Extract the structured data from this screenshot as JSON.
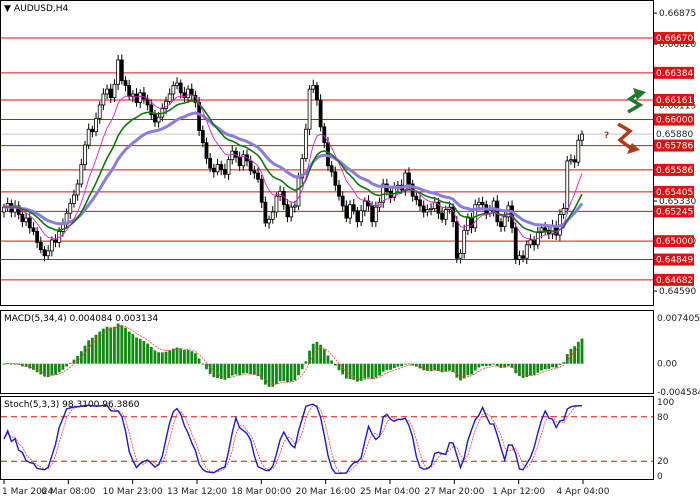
{
  "chart": {
    "symbol": "AUDUSD,H4"
  },
  "colors": {
    "candle": "#000000",
    "level": "#dd1111",
    "level_tag_bg": "#dd1111",
    "ma_green": "#0a7a0a",
    "ma_blue": "#8a7ce0",
    "ma_magenta": "#dd22cc",
    "macd_hist": "#118811",
    "macd_signal": "#ff3b3b",
    "stoch_main": "#1a1acc",
    "stoch_signal": "#ff3b3b",
    "stoch_level": "#dd1111",
    "up_arrow": "#1f7a30",
    "down_arrow": "#b33a1a",
    "grid": "#c8c8c8"
  },
  "arrows": {
    "up_icon": "up-zigzag-arrow-icon",
    "down_icon": "down-zigzag-arrow-icon",
    "question_mark": "?"
  },
  "macd": {
    "label": "MACD(5,34,4) 0.004084 0.003134"
  },
  "stoch": {
    "label": "Stoch(5,3,3) 98.3100 96.3860"
  },
  "chart_data": [
    {
      "type": "candlestick",
      "name": "price",
      "title": "AUDUSD,H4",
      "ylim": [
        0.645,
        0.6695
      ],
      "y_axis_labels": [
        "0.66875",
        "0.66620",
        "0.66115",
        "0.65330",
        "0.65000",
        "0.64590"
      ],
      "levels": [
        {
          "value": 0.6667,
          "label": "0.66670"
        },
        {
          "value": 0.66384,
          "label": "0.66384"
        },
        {
          "value": 0.66161,
          "label": "0.66161"
        },
        {
          "value": 0.66,
          "label": "0.66000"
        },
        {
          "value": 0.6588,
          "label": "0.65880",
          "current": true
        },
        {
          "value": 0.65786,
          "label": "0.65786"
        },
        {
          "value": 0.65586,
          "label": "0.65586"
        },
        {
          "value": 0.65405,
          "label": "0.65405"
        },
        {
          "value": 0.65245,
          "label": "0.65245"
        },
        {
          "value": 0.65,
          "label": "0.65000"
        },
        {
          "value": 0.64849,
          "label": "0.64849"
        },
        {
          "value": 0.64682,
          "label": "0.64682"
        }
      ],
      "x_labels": [
        "1 Mar 2024",
        "6 Mar 08:00",
        "10 Mar 23:00",
        "13 Mar 12:00",
        "18 Mar 00:00",
        "20 Mar 16:00",
        "25 Mar 04:00",
        "27 Mar 20:00",
        "1 Apr 12:00",
        "4 Apr 04:00"
      ],
      "close": [
        0.6528,
        0.6531,
        0.6524,
        0.6529,
        0.6522,
        0.6516,
        0.6519,
        0.6511,
        0.6508,
        0.6499,
        0.6493,
        0.6488,
        0.6492,
        0.6501,
        0.6499,
        0.6508,
        0.6514,
        0.6523,
        0.6531,
        0.6538,
        0.6547,
        0.6563,
        0.6579,
        0.6592,
        0.659,
        0.6601,
        0.6612,
        0.6621,
        0.6625,
        0.6618,
        0.6629,
        0.6649,
        0.6632,
        0.6628,
        0.6619,
        0.6621,
        0.6614,
        0.6622,
        0.6617,
        0.6612,
        0.6604,
        0.6598,
        0.6602,
        0.6609,
        0.6615,
        0.6621,
        0.6628,
        0.663,
        0.6622,
        0.6618,
        0.6625,
        0.662,
        0.6614,
        0.6591,
        0.6581,
        0.6568,
        0.656,
        0.6557,
        0.6563,
        0.6559,
        0.6555,
        0.6567,
        0.6574,
        0.6569,
        0.6562,
        0.6571,
        0.6566,
        0.6558,
        0.6556,
        0.6551,
        0.6532,
        0.6515,
        0.6518,
        0.6524,
        0.6537,
        0.6541,
        0.653,
        0.652,
        0.6528,
        0.6529,
        0.6552,
        0.6568,
        0.6592,
        0.6625,
        0.6628,
        0.6616,
        0.6594,
        0.6581,
        0.6562,
        0.6557,
        0.6546,
        0.6537,
        0.6529,
        0.6519,
        0.653,
        0.6525,
        0.6516,
        0.6525,
        0.6533,
        0.6529,
        0.6516,
        0.6528,
        0.6532,
        0.6547,
        0.6541,
        0.6536,
        0.6544,
        0.6546,
        0.6542,
        0.6556,
        0.6547,
        0.6537,
        0.6534,
        0.6529,
        0.6524,
        0.6526,
        0.6527,
        0.6532,
        0.6523,
        0.6518,
        0.6526,
        0.6528,
        0.6516,
        0.6486,
        0.649,
        0.6509,
        0.6519,
        0.6511,
        0.653,
        0.6532,
        0.653,
        0.6523,
        0.6525,
        0.6533,
        0.6516,
        0.6512,
        0.652,
        0.6529,
        0.6511,
        0.6485,
        0.6488,
        0.6486,
        0.6497,
        0.6501,
        0.6497,
        0.6507,
        0.6511,
        0.6509,
        0.6506,
        0.6513,
        0.6505,
        0.6522,
        0.6527,
        0.6566,
        0.6567,
        0.6565,
        0.6583,
        0.6588
      ],
      "ma_green": "smoothed moving average",
      "ma_blue": "smoothed moving average",
      "ma_magenta": "smoothed moving average"
    },
    {
      "type": "bar",
      "name": "MACD(5,34,4)",
      "ylim": [
        -0.004584,
        0.007405
      ],
      "y_axis_labels": [
        "0.007405",
        "0.00",
        "-0.004584"
      ],
      "values_current": [
        0.004084,
        0.003134
      ]
    },
    {
      "type": "line",
      "name": "Stoch(5,3,3)",
      "ylim": [
        0,
        100
      ],
      "levels": [
        80,
        20
      ],
      "y_axis_labels": [
        "100",
        "80",
        "20",
        "0"
      ],
      "values_current": [
        98.31,
        96.386
      ]
    }
  ]
}
